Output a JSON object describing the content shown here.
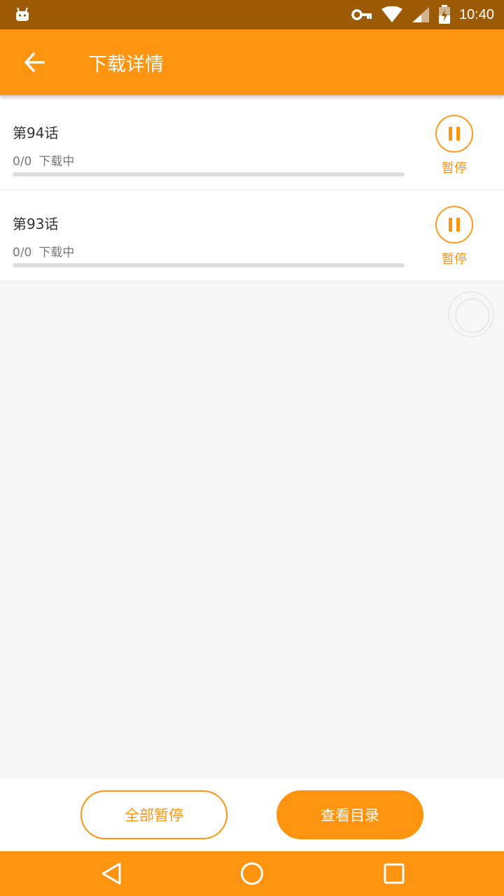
{
  "status_bar": {
    "time": "10:40",
    "icons": [
      "android-icon",
      "key-icon",
      "wifi-icon",
      "signal-icon",
      "battery-icon"
    ]
  },
  "app_bar": {
    "title": "下载详情",
    "back_icon": "arrow-back-icon"
  },
  "downloads": [
    {
      "name": "第94话",
      "progress_text": "0/0",
      "state": "下载中",
      "action_label": "暂停",
      "progress": 0
    },
    {
      "name": "第93话",
      "progress_text": "0/0",
      "state": "下载中",
      "action_label": "暂停",
      "progress": 0
    }
  ],
  "bottom": {
    "pause_all_label": "全部暂停",
    "view_catalog_label": "查看目录"
  },
  "nav": [
    "back-nav-icon",
    "home-nav-icon",
    "recents-nav-icon"
  ],
  "colors": {
    "accent": "#ff9410",
    "status_bar": "#9c5a05",
    "background": "#f7f7f7"
  }
}
